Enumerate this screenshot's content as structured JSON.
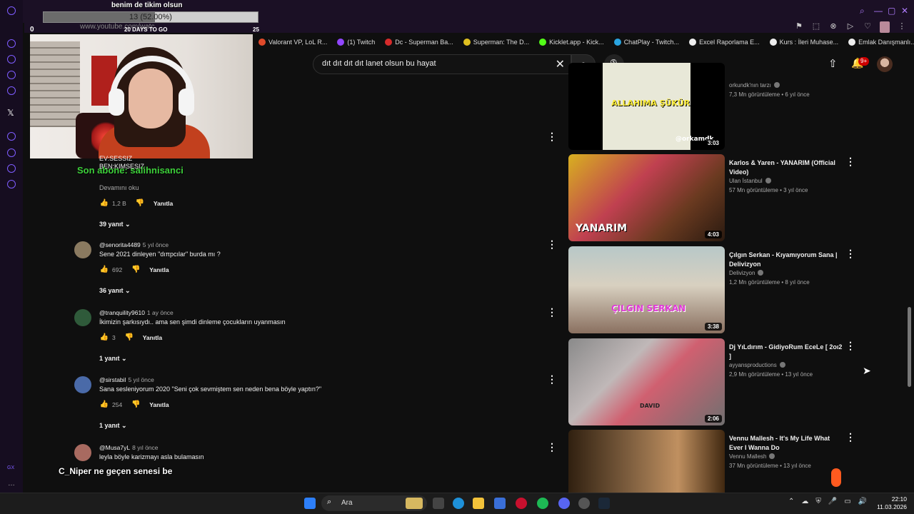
{
  "stream_overlay": {
    "goal_title": "benim de tikim olsun",
    "goal_progress": "13 (52.00%)",
    "goal_fraction": 0.52,
    "goal_min": "0",
    "goal_days": "20 DAYS TO GO",
    "goal_max": "25",
    "alert_name": "Son abone: salihnisanci",
    "chat_user": "C_Niper",
    "chat_text": "ne geçen senesi be"
  },
  "browser": {
    "url": "www.youtube.com/watc",
    "bookmarks": [
      {
        "label": "Valorant VP, LoL R...",
        "color": "#e04a2a"
      },
      {
        "label": "(1) Twitch",
        "color": "#9146ff"
      },
      {
        "label": "Dc - Superman Ba...",
        "color": "#d62b2b"
      },
      {
        "label": "Superman: The D...",
        "color": "#e0c020"
      },
      {
        "label": "Kicklet.app - Kick...",
        "color": "#53fc18"
      },
      {
        "label": "ChatPlay - Twitch...",
        "color": "#2aa4e0"
      },
      {
        "label": "Excel Raporlama E...",
        "color": "#eeeeee"
      },
      {
        "label": "Kurs : İleri Muhase...",
        "color": "#eeeeee"
      },
      {
        "label": "Emlak Danışmanlı...",
        "color": "#eeeeee"
      }
    ]
  },
  "youtube": {
    "search_query": "dıt dıt dıt dıt lanet olsun bu hayat",
    "notif_count": "9+"
  },
  "comments_partial": {
    "lines": [
      "EV:SESSIZ",
      "BEN:KIMSESIZ"
    ],
    "read_more": "Devamını oku",
    "likes": "1,2 B",
    "reply_label": "Yanıtla",
    "replies": "39 yanıt"
  },
  "comments": [
    {
      "author": "@senorita4489",
      "time": "5 yıl önce",
      "text": "Sene 2021 dinleyen \"dıπpcılar\" burda mı ?",
      "likes": "692",
      "reply_label": "Yanıtla",
      "replies": "36 yanıt"
    },
    {
      "author": "@tranquility9610",
      "time": "1 ay önce",
      "text": "İkimizin şarkısıydı.. ama sen şimdi dinleme çocukların uyanmasın",
      "likes": "3",
      "reply_label": "Yanıtla",
      "replies": "1 yanıt"
    },
    {
      "author": "@sirstabil",
      "time": "5 yıl önce",
      "text": "Sana sesleniyorum 2020 \"Seni çok sevmiştem sen neden bena böyle yaptın?\"",
      "likes": "254",
      "reply_label": "Yanıtla",
      "replies": "1 yanıt"
    },
    {
      "author": "@Musa7yL",
      "time": "8 yıl önce",
      "text": "leyla böyle karizmayı asla bulamasın",
      "likes": "",
      "reply_label": "",
      "replies": ""
    }
  ],
  "videos": [
    {
      "title": "",
      "channel": "orkundk'nın tarzı",
      "meta": "7,3 Mn görüntüleme • 6 yıl önce",
      "duration": "3:03",
      "thumb_text": "ALLAHIMA ŞÜKÜR",
      "thumb_text2": "@orkamdk"
    },
    {
      "title": "Karlos & Yaren - YANARIM (Official Video)",
      "channel": "Ulan İstanbul",
      "meta": "57 Mn görüntüleme • 3 yıl önce",
      "duration": "4:03",
      "thumb_text": "YANARIM",
      "thumb_text2": ""
    },
    {
      "title": "Çılgın Serkan - Kıyamıyorum Sana | Delivizyon",
      "channel": "Delivizyon",
      "meta": "1,2 Mn görüntüleme • 8 yıl önce",
      "duration": "3:38",
      "thumb_text": "ÇILGIN SERKAN",
      "thumb_text2": ""
    },
    {
      "title": "Dj YıLdırım - GidiyoRum EceLe [ 2oı2 ]",
      "channel": "ayyansproductions",
      "meta": "2,9 Mn görüntüleme • 13 yıl önce",
      "duration": "2:06",
      "thumb_text": "DAVID",
      "thumb_text2": ""
    },
    {
      "title": "Vennu Mallesh - It's My Life What Ever I Wanna Do",
      "channel": "Vennu Mallesh",
      "meta": "37 Mn görüntüleme • 13 yıl önce",
      "duration": "",
      "thumb_text": "",
      "thumb_text2": ""
    }
  ],
  "taskbar": {
    "search_label": "Ara",
    "time": "22:10",
    "date": "11.03.2026"
  }
}
